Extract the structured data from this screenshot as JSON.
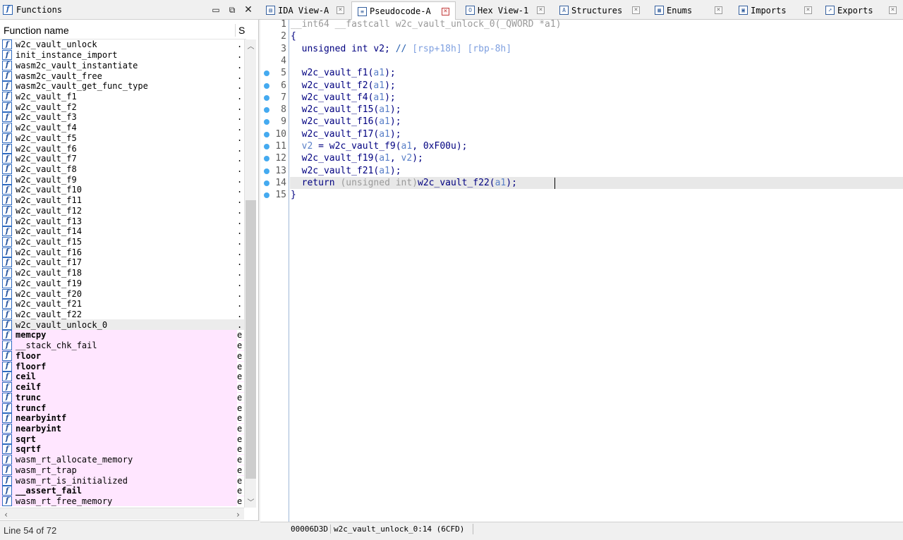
{
  "functions_panel": {
    "title": "Functions",
    "column_name": "Function name",
    "column_segment": "S",
    "status": "Line 54 of 72",
    "rows": [
      {
        "name": "w2c_vault_unlock",
        "seg": ".",
        "lib": false,
        "bold": false
      },
      {
        "name": "init_instance_import",
        "seg": ".",
        "lib": false,
        "bold": false
      },
      {
        "name": "wasm2c_vault_instantiate",
        "seg": ".",
        "lib": false,
        "bold": false
      },
      {
        "name": "wasm2c_vault_free",
        "seg": ".",
        "lib": false,
        "bold": false
      },
      {
        "name": "wasm2c_vault_get_func_type",
        "seg": ".",
        "lib": false,
        "bold": false
      },
      {
        "name": "w2c_vault_f1",
        "seg": ".",
        "lib": false,
        "bold": false
      },
      {
        "name": "w2c_vault_f2",
        "seg": ".",
        "lib": false,
        "bold": false
      },
      {
        "name": "w2c_vault_f3",
        "seg": ".",
        "lib": false,
        "bold": false
      },
      {
        "name": "w2c_vault_f4",
        "seg": ".",
        "lib": false,
        "bold": false
      },
      {
        "name": "w2c_vault_f5",
        "seg": ".",
        "lib": false,
        "bold": false
      },
      {
        "name": "w2c_vault_f6",
        "seg": ".",
        "lib": false,
        "bold": false
      },
      {
        "name": "w2c_vault_f7",
        "seg": ".",
        "lib": false,
        "bold": false
      },
      {
        "name": "w2c_vault_f8",
        "seg": ".",
        "lib": false,
        "bold": false
      },
      {
        "name": "w2c_vault_f9",
        "seg": ".",
        "lib": false,
        "bold": false
      },
      {
        "name": "w2c_vault_f10",
        "seg": ".",
        "lib": false,
        "bold": false
      },
      {
        "name": "w2c_vault_f11",
        "seg": ".",
        "lib": false,
        "bold": false
      },
      {
        "name": "w2c_vault_f12",
        "seg": ".",
        "lib": false,
        "bold": false
      },
      {
        "name": "w2c_vault_f13",
        "seg": ".",
        "lib": false,
        "bold": false
      },
      {
        "name": "w2c_vault_f14",
        "seg": ".",
        "lib": false,
        "bold": false
      },
      {
        "name": "w2c_vault_f15",
        "seg": ".",
        "lib": false,
        "bold": false
      },
      {
        "name": "w2c_vault_f16",
        "seg": ".",
        "lib": false,
        "bold": false
      },
      {
        "name": "w2c_vault_f17",
        "seg": ".",
        "lib": false,
        "bold": false
      },
      {
        "name": "w2c_vault_f18",
        "seg": ".",
        "lib": false,
        "bold": false
      },
      {
        "name": "w2c_vault_f19",
        "seg": ".",
        "lib": false,
        "bold": false
      },
      {
        "name": "w2c_vault_f20",
        "seg": ".",
        "lib": false,
        "bold": false
      },
      {
        "name": "w2c_vault_f21",
        "seg": ".",
        "lib": false,
        "bold": false
      },
      {
        "name": "w2c_vault_f22",
        "seg": ".",
        "lib": false,
        "bold": false
      },
      {
        "name": "w2c_vault_unlock_0",
        "seg": ".",
        "lib": false,
        "bold": false,
        "selected": true
      },
      {
        "name": "memcpy",
        "seg": "e",
        "lib": true,
        "bold": true
      },
      {
        "name": "__stack_chk_fail",
        "seg": "e",
        "lib": true,
        "bold": false
      },
      {
        "name": "floor",
        "seg": "e",
        "lib": true,
        "bold": true
      },
      {
        "name": "floorf",
        "seg": "e",
        "lib": true,
        "bold": true
      },
      {
        "name": "ceil",
        "seg": "e",
        "lib": true,
        "bold": true
      },
      {
        "name": "ceilf",
        "seg": "e",
        "lib": true,
        "bold": true
      },
      {
        "name": "trunc",
        "seg": "e",
        "lib": true,
        "bold": true
      },
      {
        "name": "truncf",
        "seg": "e",
        "lib": true,
        "bold": true
      },
      {
        "name": "nearbyintf",
        "seg": "e",
        "lib": true,
        "bold": true
      },
      {
        "name": "nearbyint",
        "seg": "e",
        "lib": true,
        "bold": true
      },
      {
        "name": "sqrt",
        "seg": "e",
        "lib": true,
        "bold": true
      },
      {
        "name": "sqrtf",
        "seg": "e",
        "lib": true,
        "bold": true
      },
      {
        "name": "wasm_rt_allocate_memory",
        "seg": "e",
        "lib": true,
        "bold": false
      },
      {
        "name": "wasm_rt_trap",
        "seg": "e",
        "lib": true,
        "bold": false
      },
      {
        "name": "wasm_rt_is_initialized",
        "seg": "e",
        "lib": true,
        "bold": false
      },
      {
        "name": "__assert_fail",
        "seg": "e",
        "lib": true,
        "bold": true
      },
      {
        "name": "wasm_rt_free_memory",
        "seg": "e",
        "lib": true,
        "bold": false
      }
    ]
  },
  "tabs": [
    {
      "label": "IDA View-A",
      "icon": "ida-view-icon",
      "glyph": "▤",
      "active": false
    },
    {
      "label": "Pseudocode-A",
      "icon": "pseudocode-icon",
      "glyph": "≡",
      "active": true
    },
    {
      "label": "Hex View-1",
      "icon": "hex-view-icon",
      "glyph": "O",
      "active": false
    },
    {
      "label": "Structures",
      "icon": "structures-icon",
      "glyph": "A",
      "active": false
    },
    {
      "label": "Enums",
      "icon": "enums-icon",
      "glyph": "▦",
      "active": false
    },
    {
      "label": "Imports",
      "icon": "imports-icon",
      "glyph": "▣",
      "active": false
    },
    {
      "label": "Exports",
      "icon": "exports-icon",
      "glyph": "➚",
      "active": false
    }
  ],
  "pseudocode": {
    "lines": [
      {
        "num": "1",
        "dot": false,
        "parts": [
          [
            "gray",
            "__int64 __fastcall "
          ],
          [
            "gray",
            "w2c_vault_unlock_0"
          ],
          [
            "gray",
            "(_QWORD *a1)"
          ]
        ]
      },
      {
        "num": "2",
        "dot": false,
        "parts": [
          [
            "",
            "{"
          ]
        ]
      },
      {
        "num": "3",
        "dot": false,
        "parts": [
          [
            "",
            "  unsigned int v2; "
          ],
          [
            "cmt",
            "// "
          ],
          [
            "cmtv",
            "[rsp+18h] [rbp-8h]"
          ]
        ]
      },
      {
        "num": "4",
        "dot": false,
        "parts": [
          [
            "",
            ""
          ]
        ]
      },
      {
        "num": "5",
        "dot": true,
        "parts": [
          [
            "",
            "  w2c_vault_f1("
          ],
          [
            "var",
            "a1"
          ],
          [
            "",
            ");"
          ]
        ]
      },
      {
        "num": "6",
        "dot": true,
        "parts": [
          [
            "",
            "  w2c_vault_f2("
          ],
          [
            "var",
            "a1"
          ],
          [
            "",
            ");"
          ]
        ]
      },
      {
        "num": "7",
        "dot": true,
        "parts": [
          [
            "",
            "  w2c_vault_f4("
          ],
          [
            "var",
            "a1"
          ],
          [
            "",
            ");"
          ]
        ]
      },
      {
        "num": "8",
        "dot": true,
        "parts": [
          [
            "",
            "  w2c_vault_f15("
          ],
          [
            "var",
            "a1"
          ],
          [
            "",
            ");"
          ]
        ]
      },
      {
        "num": "9",
        "dot": true,
        "parts": [
          [
            "",
            "  w2c_vault_f16("
          ],
          [
            "var",
            "a1"
          ],
          [
            "",
            ");"
          ]
        ]
      },
      {
        "num": "10",
        "dot": true,
        "parts": [
          [
            "",
            "  w2c_vault_f17("
          ],
          [
            "var",
            "a1"
          ],
          [
            "",
            ");"
          ]
        ]
      },
      {
        "num": "11",
        "dot": true,
        "parts": [
          [
            "",
            "  "
          ],
          [
            "var",
            "v2"
          ],
          [
            "",
            " = w2c_vault_f9("
          ],
          [
            "var",
            "a1"
          ],
          [
            "",
            ", 0xF00u);"
          ]
        ]
      },
      {
        "num": "12",
        "dot": true,
        "parts": [
          [
            "",
            "  w2c_vault_f19("
          ],
          [
            "var",
            "a1"
          ],
          [
            "",
            ", "
          ],
          [
            "var",
            "v2"
          ],
          [
            "",
            ");"
          ]
        ]
      },
      {
        "num": "13",
        "dot": true,
        "parts": [
          [
            "",
            "  w2c_vault_f21("
          ],
          [
            "var",
            "a1"
          ],
          [
            "",
            ");"
          ]
        ]
      },
      {
        "num": "14",
        "dot": true,
        "current": true,
        "parts": [
          [
            "",
            "  return "
          ],
          [
            "gray",
            "(unsigned int)"
          ],
          [
            "",
            "w2c_vault_f22("
          ],
          [
            "var",
            "a1"
          ],
          [
            "",
            ");"
          ]
        ]
      },
      {
        "num": "15",
        "dot": true,
        "parts": [
          [
            "",
            "}"
          ]
        ]
      }
    ]
  },
  "editor_status": {
    "address": "00006D3D",
    "location": "w2c_vault_unlock_0:14 (6CFD)"
  },
  "colors": {
    "lib_row": "#ffe6ff",
    "code_text": "#000080",
    "breakpoint_dot": "#44aaf0"
  }
}
